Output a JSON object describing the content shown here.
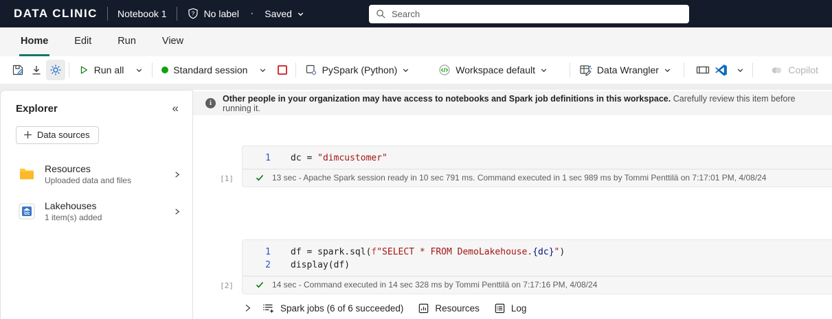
{
  "topbar": {
    "logo": "DATA CLINIC",
    "notebook_title": "Notebook 1",
    "label": "No label",
    "separator_dot": "·",
    "save_status": "Saved",
    "search_placeholder": "Search"
  },
  "menu": {
    "tabs": [
      {
        "label": "Home"
      },
      {
        "label": "Edit"
      },
      {
        "label": "Run"
      },
      {
        "label": "View"
      }
    ]
  },
  "toolbar": {
    "run_all_label": "Run all",
    "session_label": "Standard session",
    "language_label": "PySpark (Python)",
    "environment_label": "Workspace default",
    "data_wrangler_label": "Data Wrangler",
    "copilot_label": "Copilot"
  },
  "explorer": {
    "title": "Explorer",
    "collapse_icon": "«",
    "data_sources_button": "Data sources",
    "items": [
      {
        "title": "Resources",
        "subtitle": "Uploaded data and files"
      },
      {
        "title": "Lakehouses",
        "subtitle": "1 item(s) added"
      }
    ]
  },
  "banner": {
    "bold_text": "Other people in your organization may have access to notebooks and Spark job definitions in this workspace.",
    "regular_text": "Carefully review this item before running it."
  },
  "cells": [
    {
      "execution_count": "[1]",
      "lines": [
        {
          "num": "1",
          "tokens": [
            {
              "t": "dc = "
            },
            {
              "t": "\"dimcustomer\""
            }
          ]
        }
      ],
      "status": "13 sec - Apache Spark session ready in 10 sec 791 ms. Command executed in 1 sec 989 ms by Tommi Penttilä on 7:17:01 PM, 4/08/24"
    },
    {
      "execution_count": "[2]",
      "lines": [
        {
          "num": "1",
          "tokens": [
            {
              "t": "df = spark.sql("
            },
            {
              "t": "f"
            },
            {
              "t": "\"SELECT * FROM DemoLakehouse."
            },
            {
              "t": "{dc}"
            },
            {
              "t": "\""
            },
            {
              "t": ")"
            }
          ]
        },
        {
          "num": "2",
          "tokens": [
            {
              "t": "display(df)"
            }
          ]
        }
      ],
      "status": "14 sec - Command executed in 14 sec 328 ms by Tommi Penttilä on 7:17:16 PM, 4/08/24"
    }
  ],
  "jobs_bar": {
    "spark_jobs_label": "Spark jobs (6 of 6 succeeded)",
    "resources_label": "Resources",
    "log_label": "Log"
  },
  "colors": {
    "topbar_bg": "#141b2a",
    "accent_teal": "#117865",
    "run_green": "#107c10",
    "session_green": "#13a10e",
    "stop_red": "#d13438",
    "vscode_blue": "#0f6cbd",
    "code_string_red": "#a31515",
    "code_fstring_prefix_red": "#cd3131",
    "code_linenum_blue": "#2456c4",
    "folder_yellow": "#ffc83d"
  }
}
